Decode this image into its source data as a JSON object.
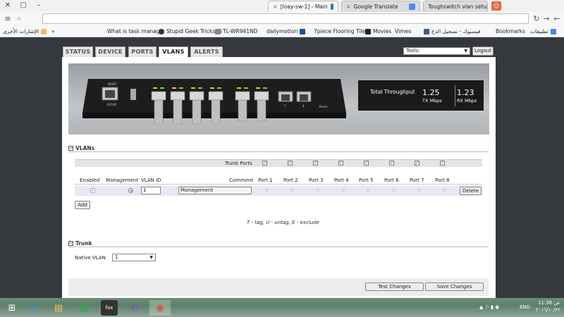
{
  "browser": {
    "tabs": [
      {
        "title": "[loay-sw-1] - Main",
        "active": true
      },
      {
        "title": "Google Translate",
        "active": false
      },
      {
        "title": "Toughswitch vlan setup",
        "active": false
      }
    ],
    "window_controls": [
      "✕",
      "▢",
      "–"
    ],
    "address": "",
    "bookmarks_left": [
      {
        "label": "تطبيقات",
        "icon": "apps-icon"
      },
      {
        "label": "Bookmarks",
        "icon": "folder-icon"
      },
      {
        "label": "فيسبوك - تسجيل الدخ",
        "icon": "facebook-icon"
      },
      {
        "label": "Vimeo",
        "icon": "vimeo-icon"
      },
      {
        "label": "Movies",
        "icon": "amazon-icon"
      },
      {
        "label": "7piece Flooring Tile a",
        "icon": "page-icon"
      },
      {
        "label": "dailymotion",
        "icon": "dailymotion-icon"
      },
      {
        "label": "TL-WR941ND",
        "icon": "page-icon"
      },
      {
        "label": "Stupid Geek Tricks: 6",
        "icon": "geek-icon"
      },
      {
        "label": "What is task manage",
        "icon": "page-icon"
      }
    ],
    "other_bookmarks": "الإشارات الأخرى",
    "more_symbol": "«"
  },
  "nav": {
    "tabs": [
      "STATUS",
      "DEVICE",
      "PORTS",
      "VLANS",
      "ALERTS"
    ],
    "active": "VLANS",
    "tools_label": "Tools:",
    "logout": "Logout"
  },
  "throughput": {
    "title": "Total Throughput",
    "tx_value": "1.25",
    "tx_unit": "TX Mbps",
    "rx_value": "1.23",
    "rx_unit": "RX Mbps"
  },
  "device_labels": {
    "mgmt": "MGMT",
    "speed": "10/100",
    "reset": "Reset",
    "port7": "7",
    "port8": "8"
  },
  "vlans": {
    "section_title": "VLANs",
    "trunk_ports_label": "Trunk Ports",
    "headers": [
      "Enabled",
      "Management",
      "VLAN ID",
      "Comment",
      "Port 1",
      "Port 2",
      "Port 3",
      "Port 4",
      "Port 5",
      "Port 6",
      "Port 7",
      "Port 8"
    ],
    "row": {
      "vlan_id": "1",
      "comment": "Management",
      "port_value": "U",
      "delete": "Delete"
    },
    "add": "Add",
    "legend": "T - tag, U - untag, E - exclude"
  },
  "trunk": {
    "section_title": "Trunk",
    "native_vlan_label": "Native VLAN:",
    "native_vlan_value": "1"
  },
  "actions": {
    "test": "Test Changes",
    "save": "Save Changes"
  },
  "taskbar": {
    "lang": "ENG",
    "time": "11:36 ص",
    "date": "٢٠١٦/١٠/٢٢"
  },
  "symbols": {
    "check": "✓",
    "minus": "−",
    "caret": "▼",
    "close": "×",
    "star": "☆",
    "menu": "≡",
    "back": "←",
    "forward": "→",
    "reload": "↻",
    "windows": "⊞",
    "ie": "e",
    "explorer": "▤",
    "store": "▦",
    "fox": "fox",
    "viber": "✆",
    "chrome": "◉",
    "tray": "▲ ⚐ ▮ ◉"
  },
  "colors": {
    "page_dark": "#35393e",
    "accent_throughput": "#1a1a1a"
  }
}
